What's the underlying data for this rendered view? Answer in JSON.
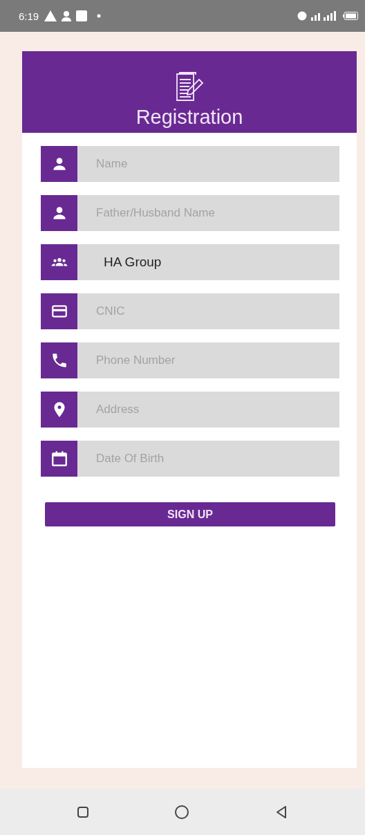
{
  "status_bar": {
    "time": "6:19"
  },
  "header": {
    "title": "Registration"
  },
  "fields": [
    {
      "kind": "person",
      "placeholder": "Name"
    },
    {
      "kind": "person",
      "placeholder": "Father/Husband Name"
    },
    {
      "kind": "group",
      "value": "HA Group"
    },
    {
      "kind": "card",
      "placeholder": "CNIC"
    },
    {
      "kind": "phone",
      "placeholder": "Phone Number"
    },
    {
      "kind": "pin",
      "placeholder": "Address"
    },
    {
      "kind": "calendar",
      "placeholder": "Date Of Birth"
    }
  ],
  "button": {
    "label": "SIGN UP"
  }
}
